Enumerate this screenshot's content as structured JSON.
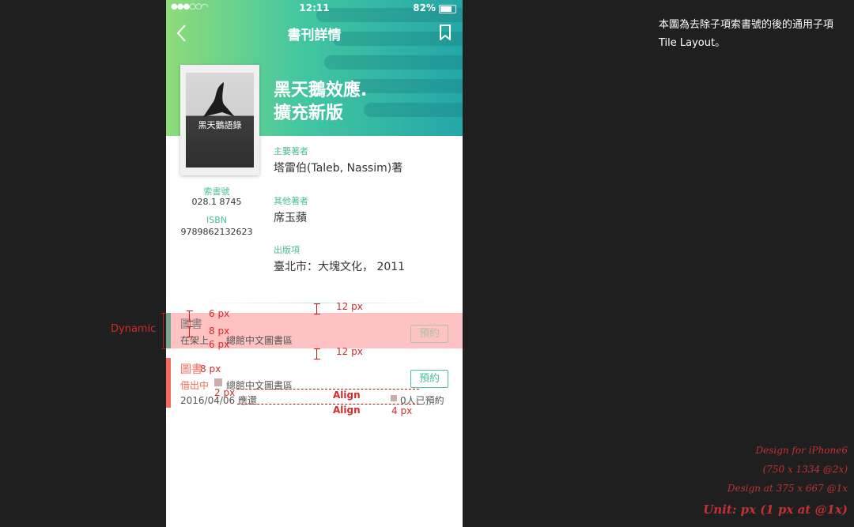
{
  "status": {
    "time": "12:11",
    "battery": "82%"
  },
  "nav": {
    "title": "書刊詳情"
  },
  "book": {
    "title_line1": "黑天鵝效應.",
    "title_line2": "擴充新版",
    "cover_title": "黑天鵝語錄",
    "call_label": "索書號",
    "call_number": "028.1 8745",
    "isbn_label": "ISBN",
    "isbn": "9789862132623",
    "fields": [
      {
        "label": "主要著者",
        "value": "塔雷伯(Taleb, Nassim)著"
      },
      {
        "label": "其他著者",
        "value": "席玉蘋"
      },
      {
        "label": "出版項",
        "value": "臺北市：大塊文化， 2011"
      }
    ]
  },
  "items": [
    {
      "type": "圖書",
      "status": "在架上",
      "location": "總館中文圖書區",
      "action": "預約"
    },
    {
      "type": "圖書",
      "status": "借出中",
      "location": "總館中文圖書區",
      "due": "2016/04/06 應還",
      "reservations": "0人已預約",
      "action": "預約"
    }
  ],
  "annotations": {
    "dynamic": "Dynamic",
    "g6a": "6 px",
    "g8a": "8 px",
    "g6b": "6 px",
    "g12a": "12 px",
    "g12b": "12 px",
    "g8b": "8 px",
    "g2": "2 px",
    "g4": "4 px",
    "align1": "Align",
    "align2": "Align"
  },
  "note": {
    "line1": "本圖為去除子項索書號的後的通用子項",
    "line2": "Tile Layout。"
  },
  "design": {
    "line1": "Design for iPhone6",
    "line2": "(750 x 1334 @2x)",
    "line3": "Design at 375 x 667 @1x",
    "line4": "Unit: px (1 px at @1x)"
  },
  "colors": {
    "accent": "#4bbf93",
    "annotation": "#d12b2b",
    "borrowed": "#f36b5b"
  }
}
